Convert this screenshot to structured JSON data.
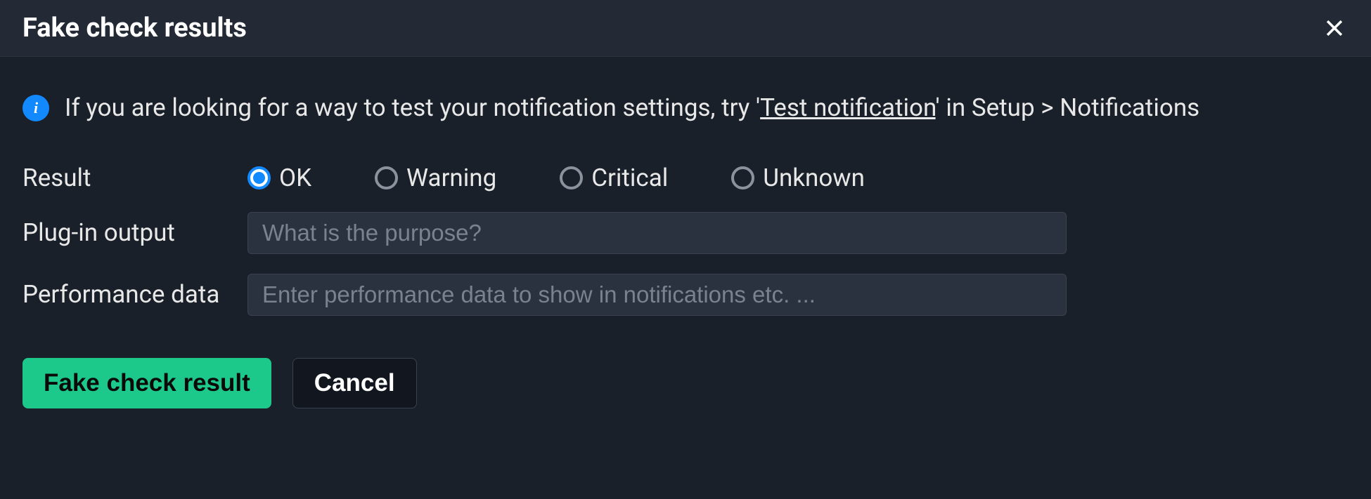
{
  "dialog": {
    "title": "Fake check results",
    "info": {
      "prefix": "If you are looking for a way to test your notification settings, try '",
      "link": "Test notification",
      "suffix": "' in Setup > Notifications"
    },
    "labels": {
      "result": "Result",
      "plugin_output": "Plug-in output",
      "performance_data": "Performance data"
    },
    "result_options": {
      "ok": "OK",
      "warning": "Warning",
      "critical": "Critical",
      "unknown": "Unknown"
    },
    "inputs": {
      "plugin_output_placeholder": "What is the purpose?",
      "performance_data_placeholder": "Enter performance data to show in notifications etc. ..."
    },
    "buttons": {
      "submit": "Fake check result",
      "cancel": "Cancel"
    }
  }
}
